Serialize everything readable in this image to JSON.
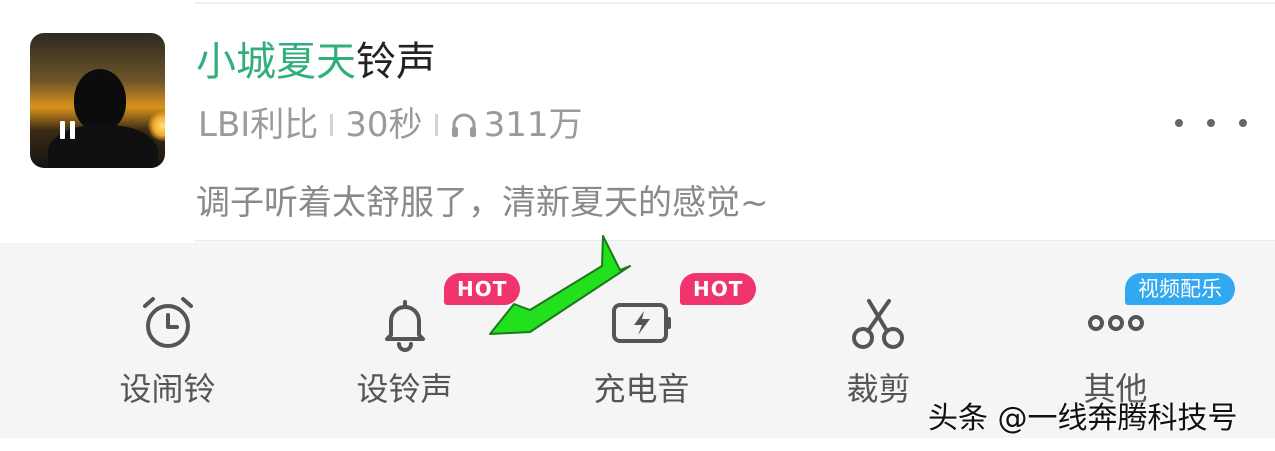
{
  "song": {
    "title_highlight": "小城夏天",
    "title_rest": "铃声",
    "artist": "LBI利比",
    "duration": "30秒",
    "play_count": "311万",
    "description": "调子听着太舒服了，清新夏天的感觉~",
    "highlight_color": "#2fb07a"
  },
  "actions": [
    {
      "label": "设闹铃",
      "icon": "alarm-clock-icon"
    },
    {
      "label": "设铃声",
      "icon": "bell-icon",
      "badge": "HOT"
    },
    {
      "label": "充电音",
      "icon": "battery-charging-icon",
      "badge": "HOT"
    },
    {
      "label": "裁剪",
      "icon": "scissors-icon"
    },
    {
      "label": "其他",
      "icon": "more-dots-icon",
      "badge": "视频配乐"
    }
  ],
  "overlay": {
    "arrow_color": "#22e01e",
    "watermark": "头条 @一线奔腾科技号"
  }
}
